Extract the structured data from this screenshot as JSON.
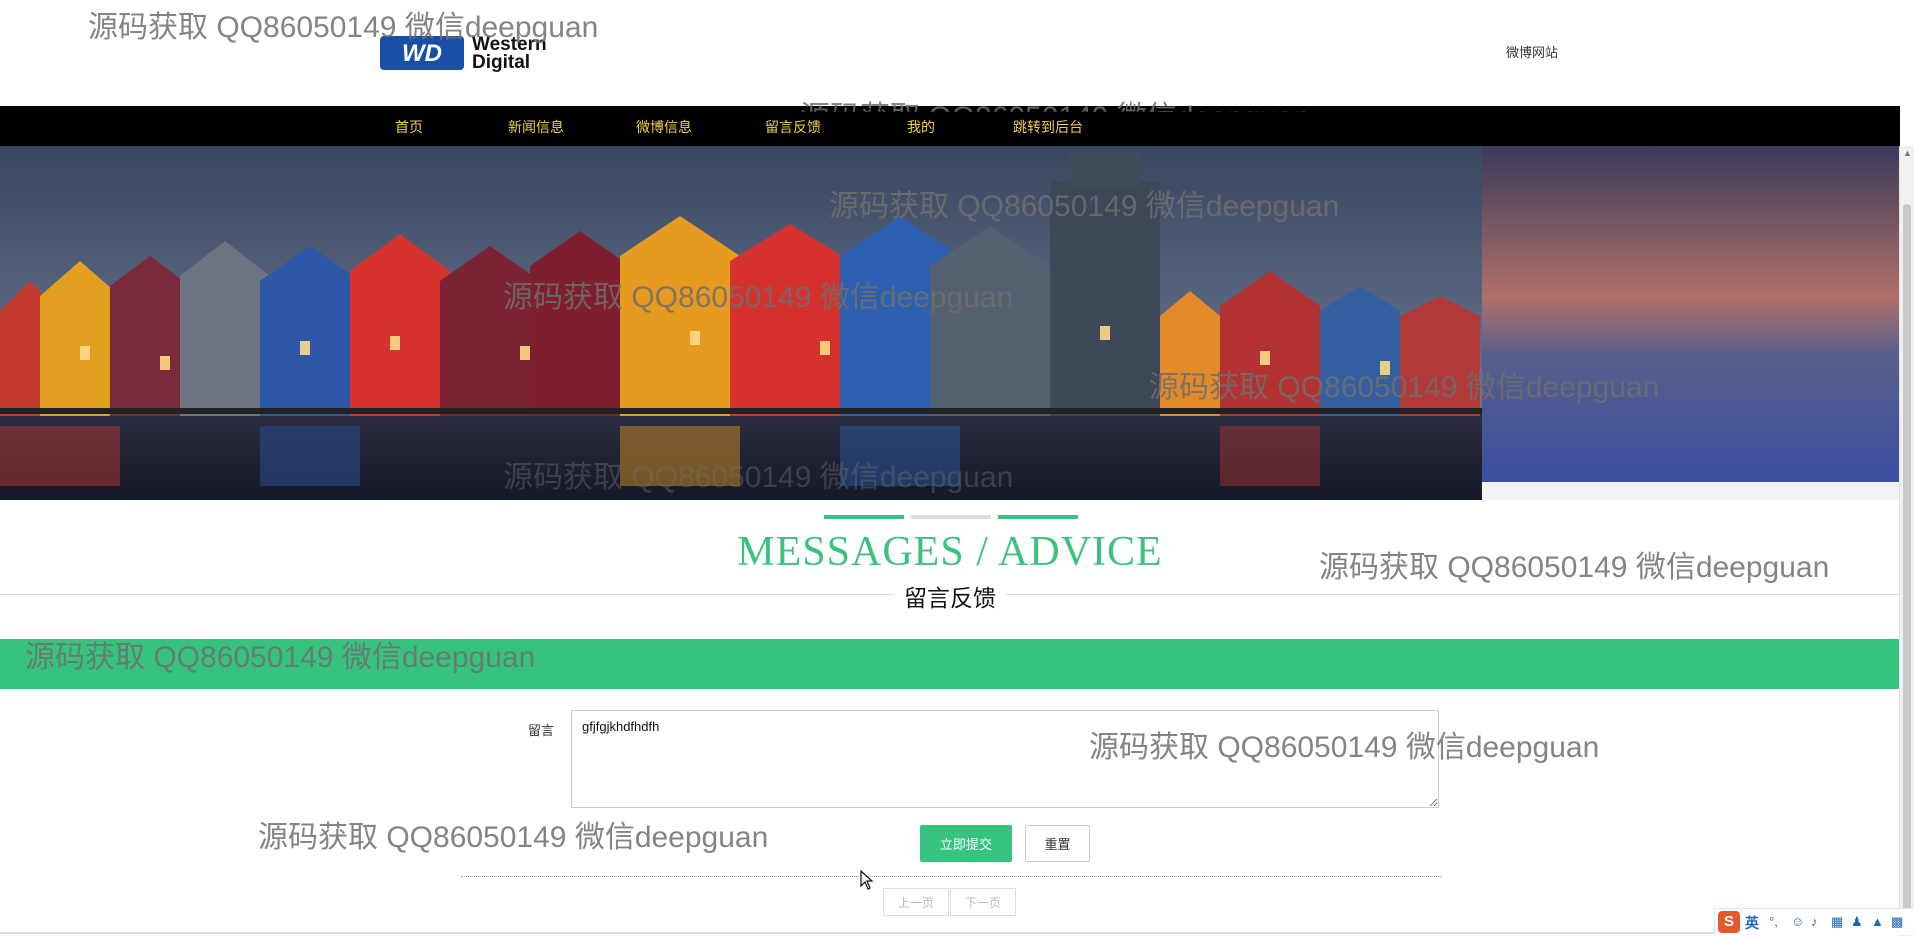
{
  "header": {
    "site_name": "微博网站",
    "logo_text": {
      "line1": "Western",
      "line2": "Digital",
      "mark": "WD"
    }
  },
  "nav": {
    "items": [
      "首页",
      "新闻信息",
      "微博信息",
      "留言反馈",
      "我的",
      "跳转到后台"
    ]
  },
  "banner": {
    "slides_count": 3,
    "active_index": 0
  },
  "section": {
    "title": "MESSAGES / ADVICE",
    "subtitle": "留言反馈"
  },
  "form": {
    "message_label": "留言",
    "message_value": "gfjfgjkhdfhdfh",
    "submit_label": "立即提交",
    "reset_label": "重置"
  },
  "pager": {
    "prev": "上一页",
    "next": "下一页"
  },
  "watermark": "源码获取 QQ86050149 微信deepguan",
  "ime": {
    "lang": "英"
  },
  "colors": {
    "accent": "#35c37e",
    "nav_bg": "#000000",
    "nav_text": "#f2d04a"
  }
}
